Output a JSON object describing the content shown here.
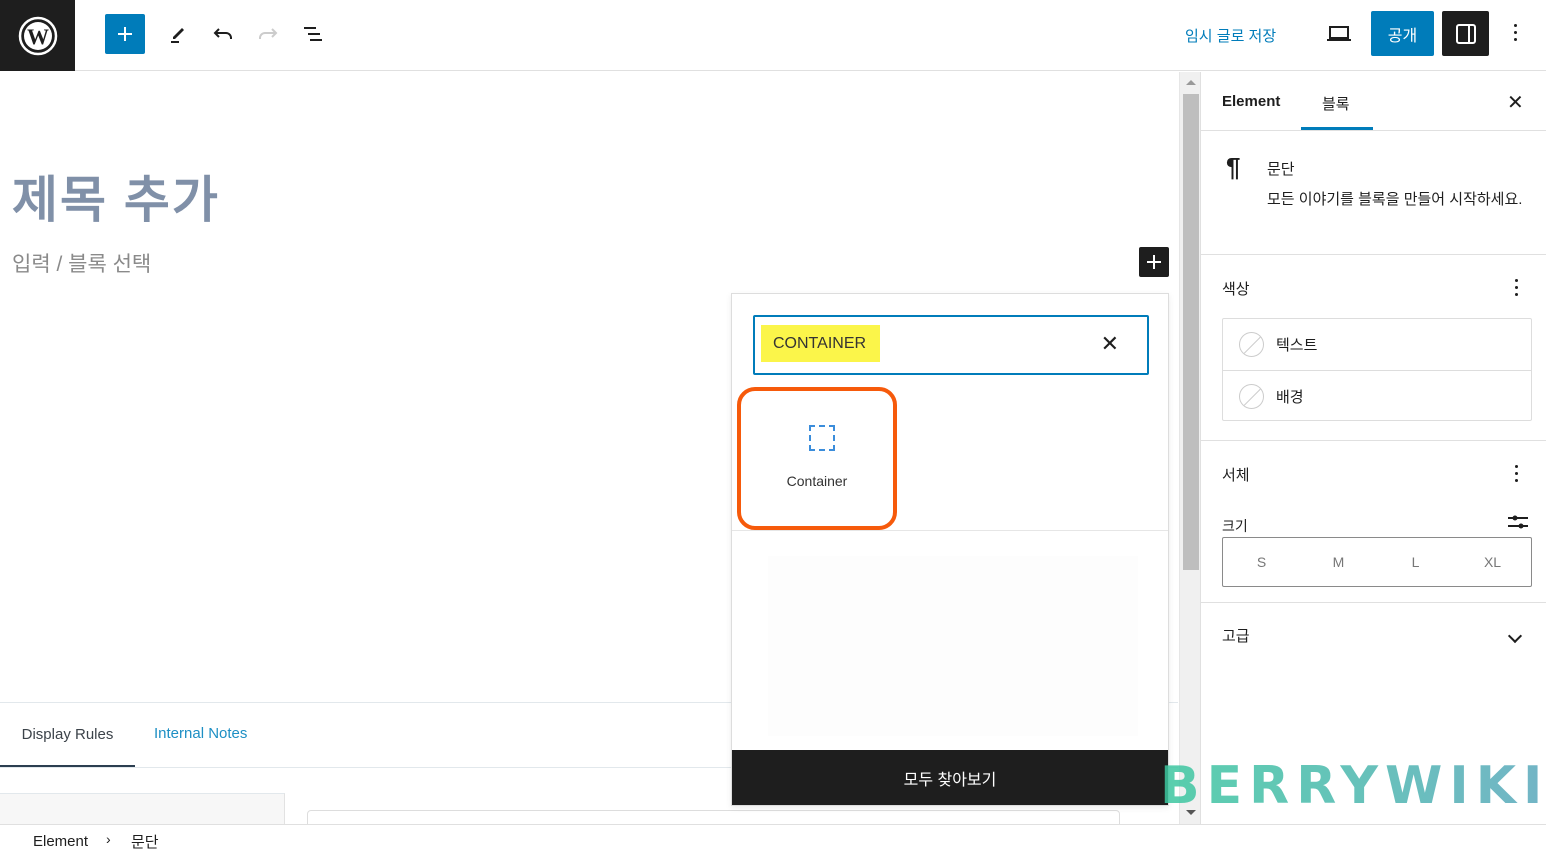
{
  "topbar": {
    "save_draft": "임시 글로 저장",
    "publish": "공개"
  },
  "editor": {
    "title_placeholder": "제목 추가",
    "body_placeholder": "입력 / 블록 선택"
  },
  "inserter_popover": {
    "search_value": "CONTAINER",
    "results": [
      {
        "label": "Container",
        "icon": "container-dashed-icon"
      }
    ],
    "browse_all": "모두 찾아보기"
  },
  "bottom_panel": {
    "tabs": [
      {
        "label": "Display Rules",
        "active": true
      },
      {
        "label": "Internal Notes",
        "active": false
      }
    ]
  },
  "sidebar": {
    "tabs": [
      {
        "label": "Element",
        "active": false
      },
      {
        "label": "블록",
        "active": true
      }
    ],
    "block": {
      "name": "문단",
      "description": "모든 이야기를 블록을 만들어 시작하세요."
    },
    "color_panel": {
      "title": "색상",
      "items": [
        {
          "label": "텍스트"
        },
        {
          "label": "배경"
        }
      ]
    },
    "typography_panel": {
      "title": "서체",
      "size_label": "크기",
      "sizes": [
        "S",
        "M",
        "L",
        "XL"
      ]
    },
    "advanced_panel": {
      "title": "고급"
    }
  },
  "breadcrumb": [
    "Element",
    "문단"
  ],
  "watermark": "BERRYWIKI",
  "colors": {
    "accent": "#007cba",
    "highlight_outline": "#f65a0b",
    "search_highlight": "#fbf54a"
  }
}
